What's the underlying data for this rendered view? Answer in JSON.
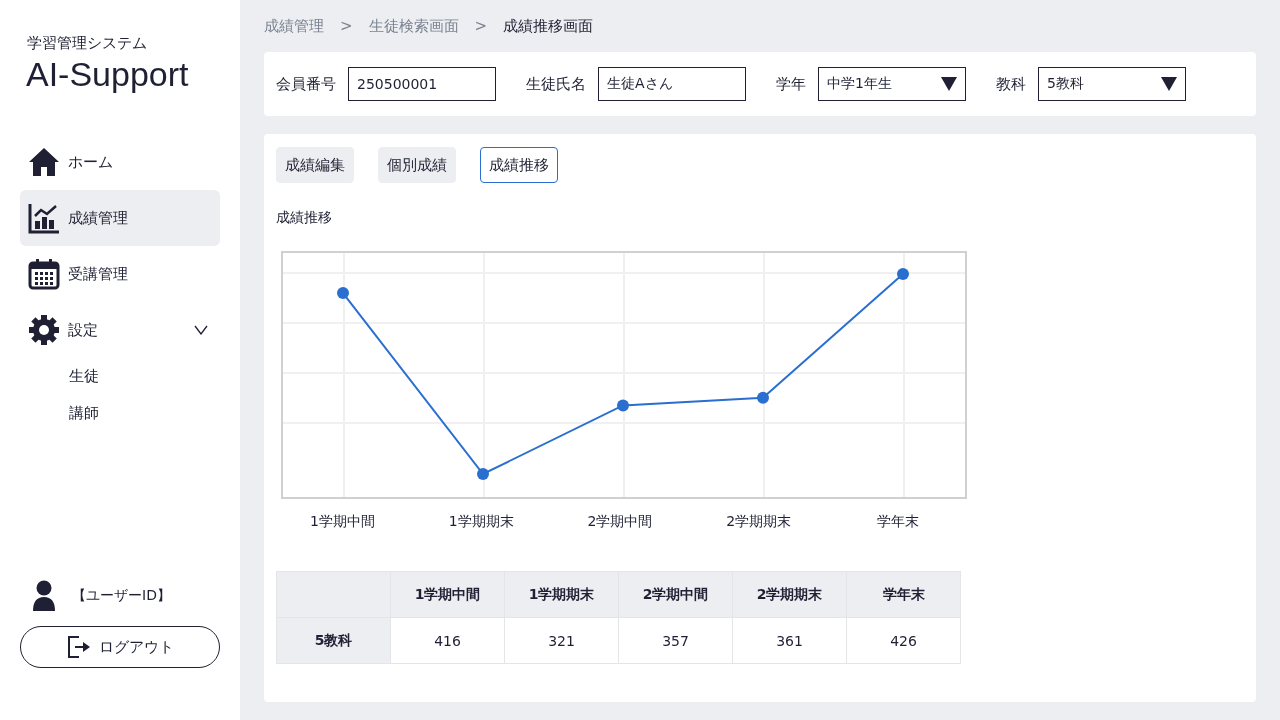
{
  "sidebar": {
    "subtitle": "学習管理システム",
    "title": "AI-Support",
    "items": [
      {
        "label": "ホーム",
        "selected": false
      },
      {
        "label": "成績管理",
        "selected": true
      },
      {
        "label": "受講管理",
        "selected": false
      },
      {
        "label": "設定",
        "selected": false,
        "expanded": true,
        "children": [
          {
            "label": "生徒"
          },
          {
            "label": "講師"
          }
        ]
      }
    ],
    "user": "【ユーザーID】",
    "logout": "ログアウト"
  },
  "breadcrumb": [
    "成績管理",
    "生徒検索画面",
    "成績推移画面"
  ],
  "breadcrumb_separator": ">",
  "filters": [
    {
      "label": "会員番号",
      "kind": "text",
      "value": "250500001"
    },
    {
      "label": "生徒氏名",
      "kind": "text",
      "value": "生徒Aさん"
    },
    {
      "label": "学年",
      "kind": "select",
      "value": "中学1年生"
    },
    {
      "label": "教科",
      "kind": "select",
      "value": "5教科"
    }
  ],
  "tabs": [
    {
      "label": "成績編集",
      "selected": false
    },
    {
      "label": "個別成績",
      "selected": false
    },
    {
      "label": "成績推移",
      "selected": true
    }
  ],
  "chart": {
    "title": "成績推移",
    "x_labels": [
      "1学期中間",
      "1学期期末",
      "2学期中間",
      "2学期期末",
      "学年末"
    ]
  },
  "table": {
    "columns": [
      "1学期中間",
      "1学期期末",
      "2学期中間",
      "2学期期末",
      "学年末"
    ],
    "rows": [
      {
        "label": "5教科",
        "values": [
          "416",
          "321",
          "357",
          "361",
          "426"
        ]
      }
    ]
  }
}
